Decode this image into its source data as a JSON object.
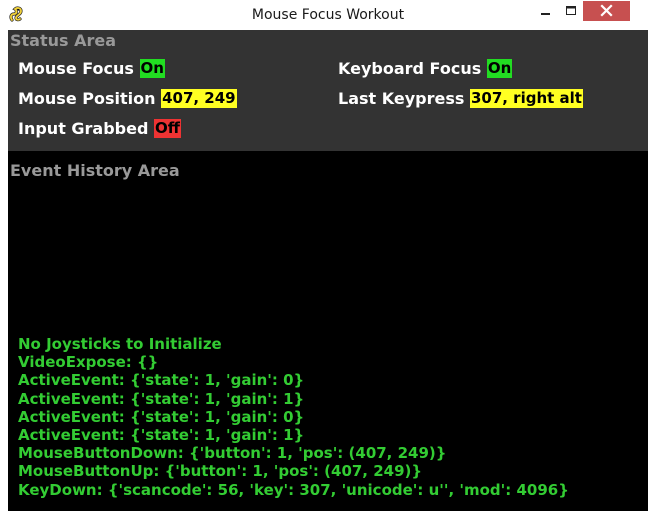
{
  "window": {
    "title": "Mouse Focus Workout",
    "app_icon": "pygame-snake-icon",
    "controls": [
      "minimize-icon",
      "maximize-icon",
      "close-icon"
    ]
  },
  "status_area": {
    "label": "Status Area",
    "items": [
      {
        "label": "Mouse Focus",
        "value": "On",
        "color": "#22dd22"
      },
      {
        "label": "Keyboard Focus",
        "value": "On",
        "color": "#22dd22"
      },
      {
        "label": "Mouse Position",
        "value": "407, 249",
        "color": "#ffff22"
      },
      {
        "label": "Last Keypress",
        "value": "307, right alt",
        "color": "#ffff22"
      },
      {
        "label": "Input Grabbed",
        "value": "Off",
        "color": "#ee3333"
      }
    ]
  },
  "history_area": {
    "label": "Event History Area",
    "events": [
      "No Joysticks to Initialize",
      "VideoExpose: {}",
      "ActiveEvent: {'state': 1, 'gain': 0}",
      "ActiveEvent: {'state': 1, 'gain': 1}",
      "ActiveEvent: {'state': 1, 'gain': 0}",
      "ActiveEvent: {'state': 1, 'gain': 1}",
      "MouseButtonDown: {'button': 1, 'pos': (407, 249)}",
      "MouseButtonUp: {'button': 1, 'pos': (407, 249)}",
      "KeyDown: {'scancode': 56, 'key': 307, 'unicode': u'', 'mod': 4096}"
    ]
  }
}
